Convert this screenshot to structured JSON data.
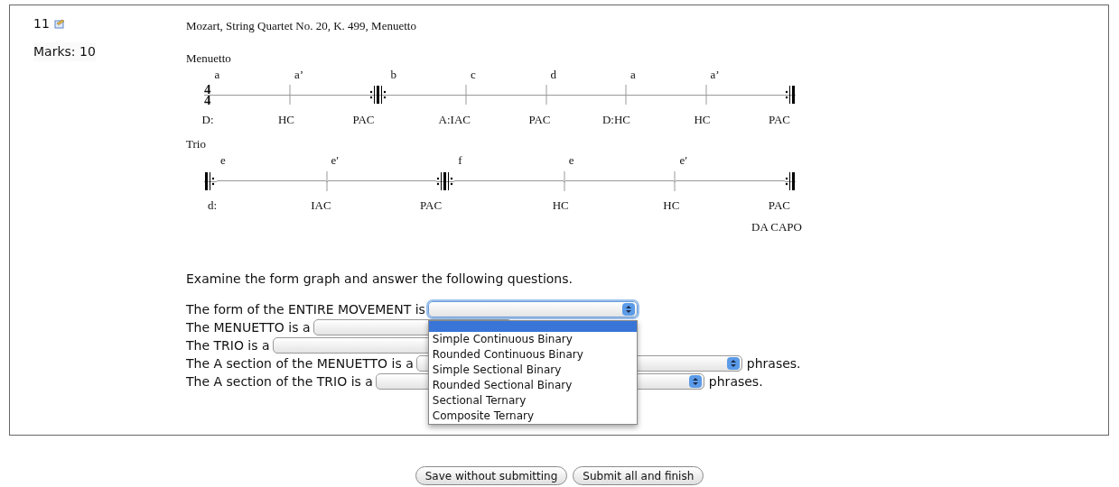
{
  "question": {
    "number": "11",
    "marks": "Marks: 10"
  },
  "title": "Mozart, String Quartet No. 20, K. 499, Menuetto",
  "systems": [
    {
      "label": "Menuetto",
      "start": {
        "kind": "time_signature"
      },
      "time_signature": {
        "numerator": "4",
        "denominator": "4"
      },
      "key": "D:",
      "segments": [
        {
          "letter": "a",
          "cadence": "HC",
          "end": {
            "kind": "tick"
          }
        },
        {
          "letter": "a’",
          "cadence": "PAC",
          "end": {
            "kind": "double_repeat"
          }
        },
        {
          "letter": "b",
          "cadence": "A:IAC",
          "end": {
            "kind": "tick"
          }
        },
        {
          "letter": "c",
          "cadence": "PAC",
          "end": {
            "kind": "tick"
          }
        },
        {
          "letter": "d",
          "cadence": "D:HC",
          "end": {
            "kind": "tick"
          }
        },
        {
          "letter": "a",
          "cadence": "HC",
          "end": {
            "kind": "tick"
          }
        },
        {
          "letter": "a’",
          "cadence": "PAC",
          "end": {
            "kind": "end_repeat"
          }
        }
      ]
    },
    {
      "label": "Trio",
      "start": {
        "kind": "start_repeat"
      },
      "key": "d:",
      "note": "DA CAPO",
      "segments": [
        {
          "letter": "e",
          "cadence": "IAC",
          "end": {
            "kind": "tick"
          }
        },
        {
          "letter": "e′",
          "cadence": "PAC",
          "end": {
            "kind": "double_repeat"
          }
        },
        {
          "letter": "f",
          "cadence": "HC",
          "end": {
            "kind": "tick"
          }
        },
        {
          "letter": "e",
          "cadence": "HC",
          "end": {
            "kind": "tick"
          }
        },
        {
          "letter": "e′",
          "cadence": "PAC",
          "end": {
            "kind": "end_repeat"
          }
        }
      ]
    }
  ],
  "instructions": "Examine the form graph and answer the following questions.",
  "questions": [
    {
      "prompt": "The form of the ENTIRE MOVEMENT is",
      "focused": true,
      "show_arrow": true
    },
    {
      "prompt": "The MENUETTO is a",
      "focused": false,
      "show_arrow": false
    },
    {
      "prompt": "The TRIO is a",
      "focused": false,
      "show_arrow": false
    },
    {
      "prompt": "The A section of the MENUETTO is a",
      "focused": false,
      "show_arrow": true,
      "suffix": "phrases."
    },
    {
      "prompt": "The A section of the TRIO is a",
      "focused": false,
      "show_arrow": true,
      "suffix": "phrases."
    }
  ],
  "dropdown": {
    "blank_highlighted": true,
    "options": [
      "Simple Continuous Binary",
      "Rounded Continuous Binary",
      "Simple Sectional Binary",
      "Rounded Sectional Binary",
      "Sectional Ternary",
      "Composite Ternary"
    ]
  },
  "buttons": [
    "Save without submitting",
    "Submit all and finish"
  ]
}
